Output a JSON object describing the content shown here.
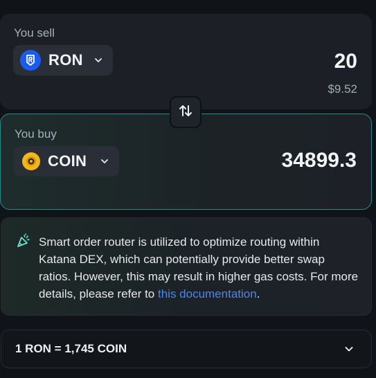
{
  "sell": {
    "label": "You sell",
    "token": "RON",
    "amount": "20",
    "usd_value": "$9.52"
  },
  "buy": {
    "label": "You buy",
    "token": "COIN",
    "amount": "34899.3"
  },
  "info": {
    "text_before_link": "Smart order router is utilized to optimize routing within Katana DEX, which can potentially provide better swap ratios. However, this may result in higher gas costs. For more details, please refer to ",
    "link_text": "this documentation",
    "text_after_link": "."
  },
  "rate": {
    "text": "1 RON = 1,745 COIN"
  },
  "icons": {
    "sell_token": "ron-logo-icon",
    "buy_token": "coin-logo-icon",
    "swap": "swap-arrows-icon",
    "info": "party-popper-icon",
    "dropdown": "chevron-down-icon"
  },
  "colors": {
    "accent_border": "#2a8a8a",
    "link": "#4d87e6",
    "ron_blue": "#1a5cf2",
    "coin_gold": "#f2b81b"
  }
}
